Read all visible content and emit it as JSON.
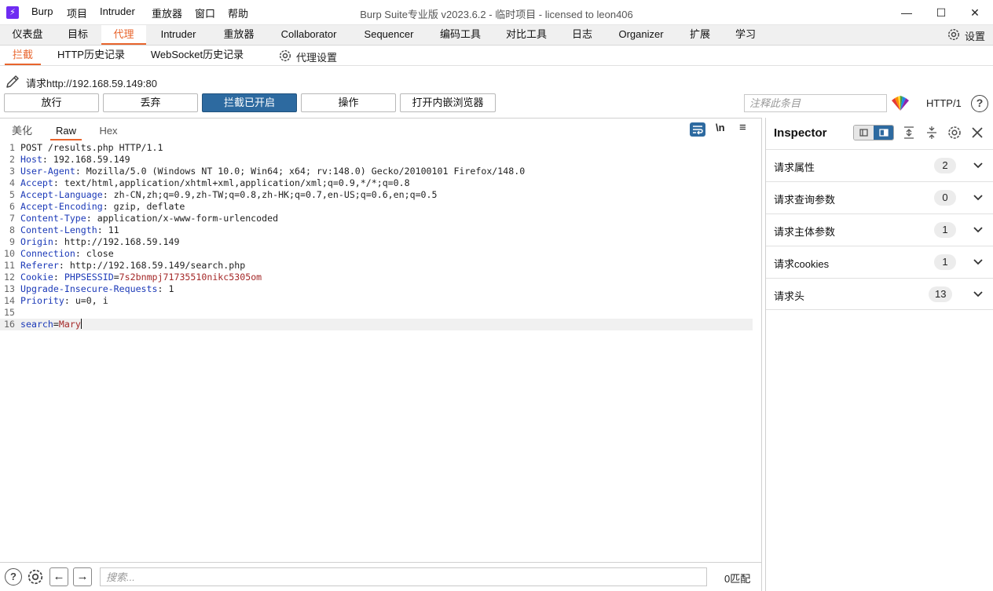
{
  "titlebar": {
    "app_icon": "burp-logo-icon",
    "menus": [
      "Burp",
      "项目",
      "Intruder",
      "重放器",
      "窗口",
      "帮助"
    ],
    "window_title": "Burp Suite专业版  v2023.6.2 - 临时项目 - licensed to leon406",
    "controls": {
      "minimize": "—",
      "maximize": "☐",
      "close": "✕"
    }
  },
  "main_tabs": [
    "仪表盘",
    "目标",
    "代理",
    "Intruder",
    "重放器",
    "Collaborator",
    "Sequencer",
    "编码工具",
    "对比工具",
    "日志",
    "Organizer",
    "扩展",
    "学习"
  ],
  "main_active": "代理",
  "settings_label": "设置",
  "sub_tabs": [
    "拦截",
    "HTTP历史记录",
    "WebSocket历史记录"
  ],
  "proxy_settings_label": "代理设置",
  "request": {
    "label": "请求http://192.168.59.149:80"
  },
  "actions": {
    "forward": "放行",
    "drop": "丢弃",
    "intercept": "拦截已开启",
    "action": "操作",
    "browser": "打开内嵌浏览器",
    "comment_placeholder": "注释此条目",
    "http_version": "HTTP/1",
    "help": "?"
  },
  "editor": {
    "tabs": [
      "美化",
      "Raw",
      "Hex"
    ],
    "active_tab": "Raw",
    "newline_label": "\\n",
    "menu_glyph": "≡",
    "lines": [
      {
        "n": "1",
        "name": "",
        "sep": "",
        "value": "POST /results.php HTTP/1.1"
      },
      {
        "n": "2",
        "name": "Host",
        "sep": ": ",
        "value": "192.168.59.149"
      },
      {
        "n": "3",
        "name": "User-Agent",
        "sep": ": ",
        "value": "Mozilla/5.0 (Windows NT 10.0; Win64; x64; rv:148.0) Gecko/20100101 Firefox/148.0"
      },
      {
        "n": "4",
        "name": "Accept",
        "sep": ": ",
        "value": "text/html,application/xhtml+xml,application/xml;q=0.9,*/*;q=0.8"
      },
      {
        "n": "5",
        "name": "Accept-Language",
        "sep": ": ",
        "value": "zh-CN,zh;q=0.9,zh-TW;q=0.8,zh-HK;q=0.7,en-US;q=0.6,en;q=0.5"
      },
      {
        "n": "6",
        "name": "Accept-Encoding",
        "sep": ": ",
        "value": "gzip, deflate"
      },
      {
        "n": "7",
        "name": "Content-Type",
        "sep": ": ",
        "value": "application/x-www-form-urlencoded"
      },
      {
        "n": "8",
        "name": "Content-Length",
        "sep": ": ",
        "value": "11"
      },
      {
        "n": "9",
        "name": "Origin",
        "sep": ": ",
        "value": "http://192.168.59.149"
      },
      {
        "n": "10",
        "name": "Connection",
        "sep": ": ",
        "value": "close"
      },
      {
        "n": "11",
        "name": "Referer",
        "sep": ": ",
        "value": "http://192.168.59.149/search.php"
      },
      {
        "n": "12",
        "name": "Cookie",
        "sep": ": ",
        "value": "",
        "cookie_name": "PHPSESSID",
        "cookie_value": "7s2bnmpj71735510nikc5305om"
      },
      {
        "n": "13",
        "name": "Upgrade-Insecure-Requests",
        "sep": ": ",
        "value": "1"
      },
      {
        "n": "14",
        "name": "Priority",
        "sep": ": ",
        "value": "u=0, i"
      },
      {
        "n": "15",
        "name": "",
        "sep": "",
        "value": ""
      },
      {
        "n": "16",
        "name": "search",
        "sep": "=",
        "value": "",
        "param_value": "Mary",
        "current": true
      }
    ]
  },
  "bottom": {
    "help": "?",
    "back": "←",
    "forward": "→",
    "search_placeholder": "搜索...",
    "match_count": "0匹配"
  },
  "inspector": {
    "title": "Inspector",
    "rows": [
      {
        "label": "请求属性",
        "count": "2"
      },
      {
        "label": "请求查询参数",
        "count": "0"
      },
      {
        "label": "请求主体参数",
        "count": "1"
      },
      {
        "label": "请求cookies",
        "count": "1"
      },
      {
        "label": "请求头",
        "count": "13"
      }
    ]
  },
  "colors": {
    "accent": "#e8642c",
    "primary_button": "#2d6aa0",
    "header_name": "#1c3ab8",
    "cookie_value": "#a42828"
  }
}
